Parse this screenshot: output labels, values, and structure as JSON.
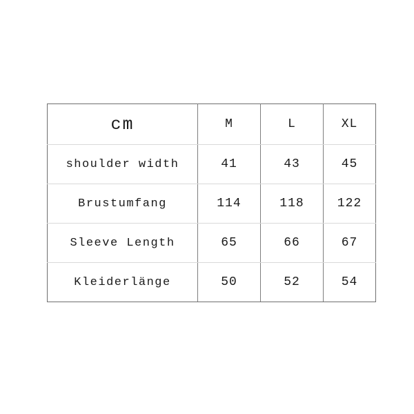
{
  "table": {
    "unit_label": "cm",
    "size_columns": [
      "M",
      "L",
      "XL"
    ],
    "rows": [
      {
        "name": "shoulder width",
        "values": [
          "41",
          "43",
          "45"
        ]
      },
      {
        "name": "Brustumfang",
        "values": [
          "114",
          "118",
          "122"
        ]
      },
      {
        "name": "Sleeve Length",
        "values": [
          "65",
          "66",
          "67"
        ]
      },
      {
        "name": "Kleiderlänge",
        "values": [
          "50",
          "52",
          "54"
        ]
      }
    ]
  },
  "colors": {
    "background": "#ffffff",
    "text": "#1a1a1a",
    "frame_border": "#6e6e6e",
    "column_divider": "#7d7d7d",
    "row_divider": "#d9d9d9"
  }
}
